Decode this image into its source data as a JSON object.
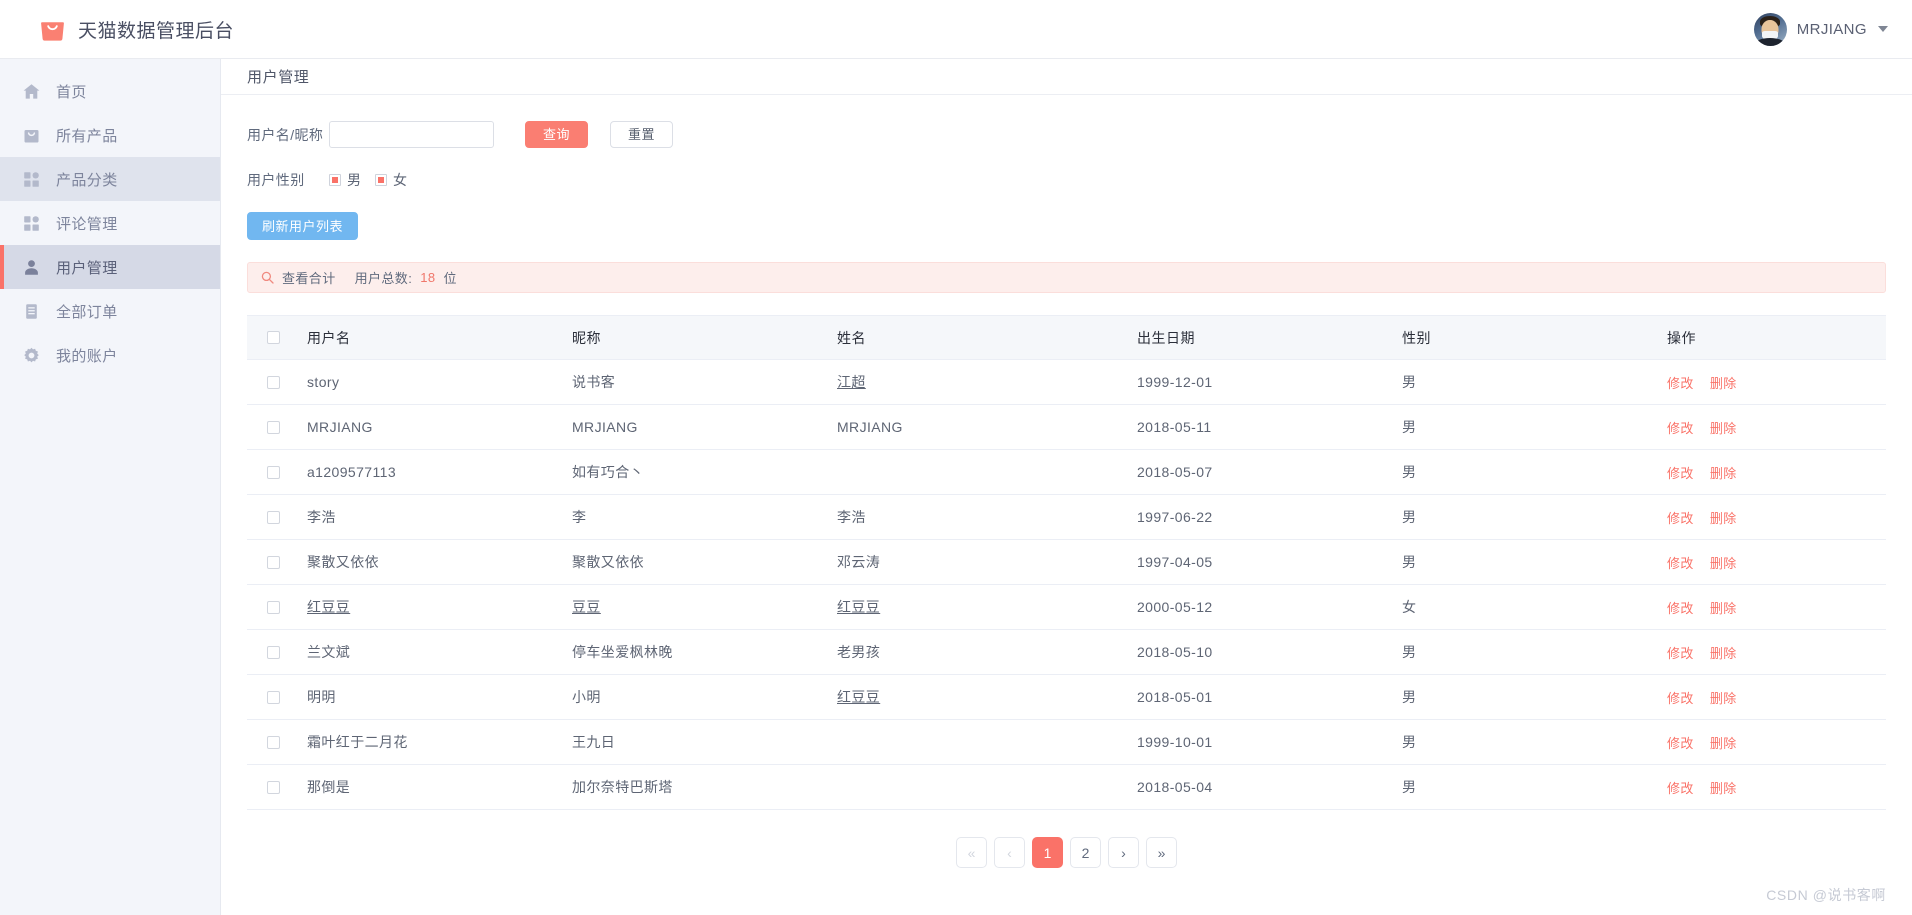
{
  "header": {
    "brand_title": "天猫数据管理后台",
    "logo_color": "#fa8072",
    "user_name": "MRJIANG"
  },
  "sidebar": {
    "items": [
      {
        "label": "首页",
        "icon": "home-icon",
        "state": "normal"
      },
      {
        "label": "所有产品",
        "icon": "bag-icon",
        "state": "normal"
      },
      {
        "label": "产品分类",
        "icon": "grid-icon",
        "state": "hovered"
      },
      {
        "label": "评论管理",
        "icon": "grid-icon",
        "state": "normal"
      },
      {
        "label": "用户管理",
        "icon": "person-icon",
        "state": "active"
      },
      {
        "label": "全部订单",
        "icon": "document-icon",
        "state": "normal"
      },
      {
        "label": "我的账户",
        "icon": "gear-icon",
        "state": "normal"
      }
    ],
    "active_accent": "#fa7268"
  },
  "page": {
    "title": "用户管理"
  },
  "filter": {
    "username_label": "用户名/昵称",
    "username_value": "",
    "username_placeholder": "",
    "search_button": "查询",
    "reset_button": "重置",
    "gender_label": "用户性别",
    "gender_options": [
      {
        "label": "男",
        "checked": true
      },
      {
        "label": "女",
        "checked": true
      }
    ],
    "refresh_button": "刷新用户列表"
  },
  "alert": {
    "icon": "search-icon",
    "text": "查看合计",
    "count_label": "用户总数:",
    "count_value": "18",
    "count_unit": "位",
    "accent": "#f0776b",
    "background": "#fdeeec"
  },
  "table": {
    "headers": [
      "用户名",
      "昵称",
      "姓名",
      "出生日期",
      "性别",
      "操作"
    ],
    "action_edit": "修改",
    "action_delete": "删除",
    "rows": [
      {
        "username": "story",
        "username_link": false,
        "nickname": "说书客",
        "nickname_link": false,
        "name": "江超",
        "name_link": true,
        "birth": "1999-12-01",
        "gender": "男"
      },
      {
        "username": "MRJIANG",
        "username_link": false,
        "nickname": "MRJIANG",
        "nickname_link": false,
        "name": "MRJIANG",
        "name_link": false,
        "birth": "2018-05-11",
        "gender": "男"
      },
      {
        "username": "a1209577113",
        "username_link": false,
        "nickname": "如有巧合丶",
        "nickname_link": false,
        "name": "",
        "name_link": false,
        "birth": "2018-05-07",
        "gender": "男"
      },
      {
        "username": "李浩",
        "username_link": false,
        "nickname": "李",
        "nickname_link": false,
        "name": "李浩",
        "name_link": false,
        "birth": "1997-06-22",
        "gender": "男"
      },
      {
        "username": "聚散又依依",
        "username_link": false,
        "nickname": "聚散又依依",
        "nickname_link": false,
        "name": "邓云涛",
        "name_link": false,
        "birth": "1997-04-05",
        "gender": "男"
      },
      {
        "username": "红豆豆",
        "username_link": true,
        "nickname": "豆豆",
        "nickname_link": true,
        "name": "红豆豆",
        "name_link": true,
        "birth": "2000-05-12",
        "gender": "女"
      },
      {
        "username": "兰文斌",
        "username_link": false,
        "nickname": "停车坐爱枫林晚",
        "nickname_link": false,
        "name": "老男孩",
        "name_link": false,
        "birth": "2018-05-10",
        "gender": "男"
      },
      {
        "username": "明明",
        "username_link": false,
        "nickname": "小明",
        "nickname_link": false,
        "name": "红豆豆",
        "name_link": true,
        "birth": "2018-05-01",
        "gender": "男"
      },
      {
        "username": "霜叶红于二月花",
        "username_link": false,
        "nickname": "王九日",
        "nickname_link": false,
        "name": "",
        "name_link": false,
        "birth": "1999-10-01",
        "gender": "男"
      },
      {
        "username": "那倒是",
        "username_link": false,
        "nickname": "加尔奈特巴斯塔",
        "nickname_link": false,
        "name": "",
        "name_link": false,
        "birth": "2018-05-04",
        "gender": "男"
      }
    ]
  },
  "pagination": {
    "items": [
      {
        "label": "«",
        "name": "first-page",
        "state": "disabled"
      },
      {
        "label": "‹",
        "name": "prev-page",
        "state": "disabled"
      },
      {
        "label": "1",
        "name": "page-1",
        "state": "active"
      },
      {
        "label": "2",
        "name": "page-2",
        "state": "normal"
      },
      {
        "label": "›",
        "name": "next-page",
        "state": "normal"
      },
      {
        "label": "»",
        "name": "last-page",
        "state": "normal"
      }
    ],
    "active_color": "#fa7268"
  },
  "watermark": {
    "text": "CSDN @说书客啊"
  }
}
